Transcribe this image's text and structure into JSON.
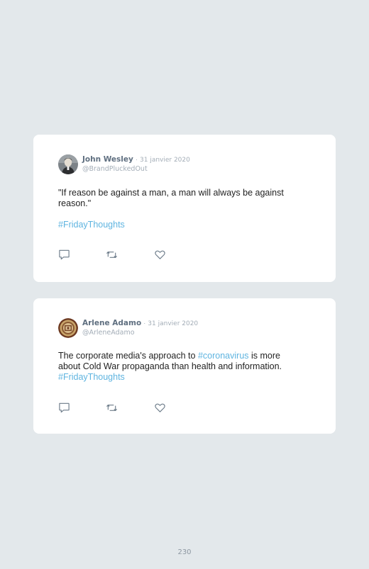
{
  "tweets": [
    {
      "author": "John Wesley",
      "separator": "·",
      "date": "31 janvier 2020",
      "handle": "@BrandPluckedOut",
      "text_line_1": "\"If reason be against a man, a man will always be against",
      "text_line_2": "reason.\"",
      "hashtag": "#FridayThoughts",
      "avatar_icon": "person-portrait-icon"
    },
    {
      "author": "Arlene Adamo",
      "separator": "·",
      "date": "31 janvier 2020",
      "handle": "@ArleneAdamo",
      "text_part_1": "The corporate media's approach to ",
      "inline_hashtag": "#coronavirus",
      "text_part_2": " is more",
      "text_line_2": "about Cold War propaganda than health and information.",
      "hashtag": "#FridayThoughts",
      "avatar_icon": "seal-emblem-icon"
    }
  ],
  "actions": [
    "reply-icon",
    "retweet-icon",
    "like-icon"
  ],
  "page_number": "230",
  "colors": {
    "background": "#e3e8eb",
    "card": "#ffffff",
    "hashtag": "#5eb4e0",
    "name": "#5f6f80",
    "muted": "#a3adb7"
  }
}
